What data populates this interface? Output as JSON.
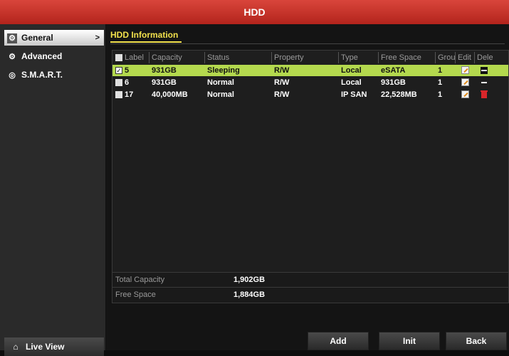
{
  "window": {
    "title": "HDD"
  },
  "sidebar": {
    "items": [
      {
        "label": "General",
        "icon": "gear-icon",
        "active": true
      },
      {
        "label": "Advanced",
        "icon": "tools-icon",
        "active": false
      },
      {
        "label": "S.M.A.R.T.",
        "icon": "disk-icon",
        "active": false
      }
    ],
    "live_view": "Live View"
  },
  "tab": {
    "label": "HDD Information"
  },
  "table": {
    "columns": [
      "Label",
      "Capacity",
      "Status",
      "Property",
      "Type",
      "Free Space",
      "Grou",
      "Edit",
      "Dele"
    ],
    "rows": [
      {
        "label": "5",
        "capacity": "931GB",
        "status": "Sleeping",
        "property": "R/W",
        "type": "Local",
        "free": "eSATA",
        "group": "1",
        "selected": true
      },
      {
        "label": "6",
        "capacity": "931GB",
        "status": "Normal",
        "property": "R/W",
        "type": "Local",
        "free": "931GB",
        "group": "1",
        "selected": false
      },
      {
        "label": "17",
        "capacity": "40,000MB",
        "status": "Normal",
        "property": "R/W",
        "type": "IP SAN",
        "free": "22,528MB",
        "group": "1",
        "selected": false
      }
    ]
  },
  "summary": {
    "total_capacity_label": "Total Capacity",
    "total_capacity_value": "1,902GB",
    "free_space_label": "Free Space",
    "free_space_value": "1,884GB"
  },
  "buttons": {
    "add": "Add",
    "init": "Init",
    "back": "Back"
  },
  "colors": {
    "title_bar": "#c2302a",
    "selected_row": "#b4d94e",
    "tab_accent": "#f2e14c"
  }
}
